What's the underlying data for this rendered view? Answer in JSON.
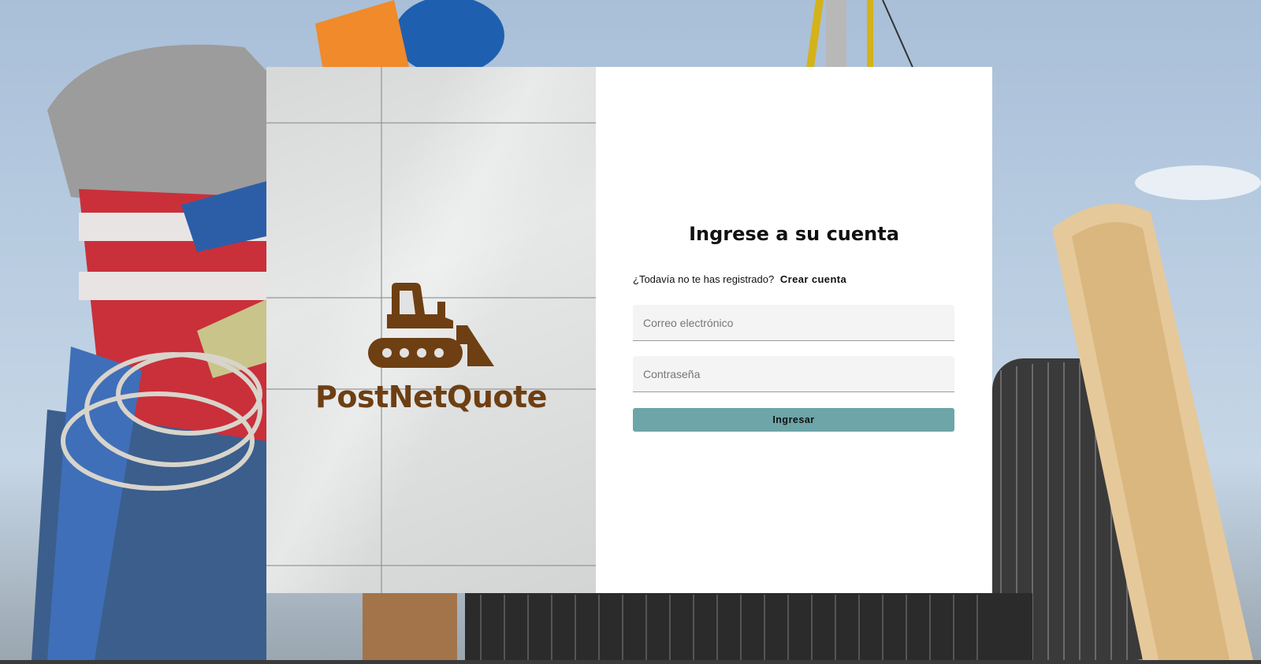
{
  "brand": {
    "name": "PostNetQuote",
    "logo_icon": "bulldozer-icon",
    "logo_color": "#6e3f13"
  },
  "login": {
    "heading": "Ingrese a su cuenta",
    "signup_prompt": "¿Todavía no te has registrado?",
    "signup_link": "Crear cuenta",
    "email_placeholder": "Correo electrónico",
    "password_placeholder": "Contraseña",
    "submit_label": "Ingresar",
    "submit_color": "#6da5a8"
  }
}
